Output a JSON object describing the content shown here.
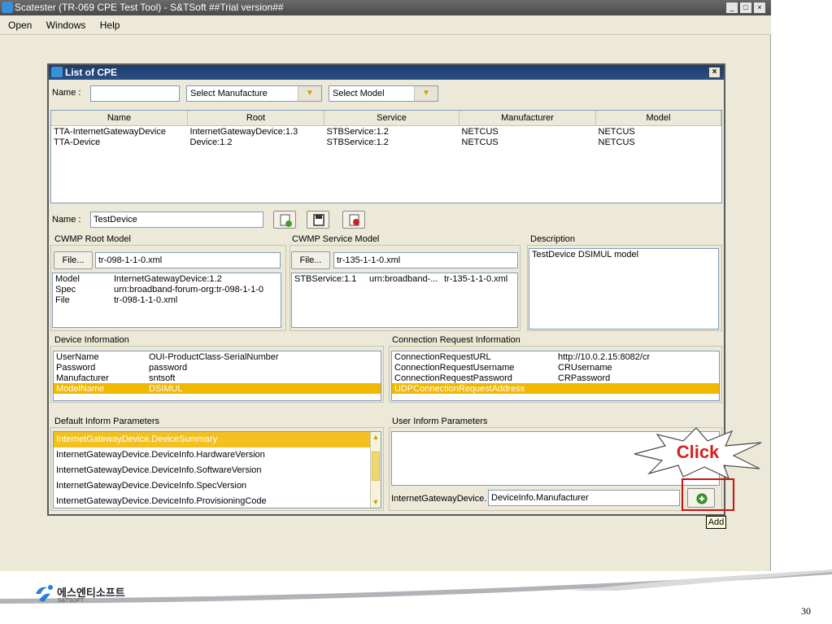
{
  "window": {
    "title": "Scatester (TR-069 CPE Test Tool) - S&TSoft ##Trial version##",
    "menu": [
      "Open",
      "Windows",
      "Help"
    ]
  },
  "cpe_dialog": {
    "title": "List of CPE",
    "filter": {
      "name_label": "Name :",
      "name_value": "",
      "manufacturer_select": "Select Manufacture",
      "model_select": "Select Model"
    },
    "table": {
      "columns": [
        "Name",
        "Root",
        "Service",
        "Manufacturer",
        "Model"
      ],
      "rows": [
        [
          "TTA-InternetGatewayDevice",
          "InternetGatewayDevice:1.3",
          "STBService:1.2",
          "NETCUS",
          "NETCUS"
        ],
        [
          "TTA-Device",
          "Device:1.2",
          "STBService:1.2",
          "NETCUS",
          "NETCUS"
        ]
      ]
    },
    "device_name": {
      "label": "Name :",
      "value": "TestDevice"
    },
    "root_model": {
      "label": "CWMP Root Model",
      "file_button": "File...",
      "file_value": "tr-098-1-1-0.xml",
      "rows": [
        [
          "Model",
          "InternetGatewayDevice:1.2"
        ],
        [
          "Spec",
          "urn:broadband-forum-org:tr-098-1-1-0"
        ],
        [
          "File",
          "tr-098-1-1-0.xml"
        ]
      ]
    },
    "service_model": {
      "label": "CWMP Service Model",
      "file_button": "File...",
      "file_value": "tr-135-1-1-0.xml",
      "rows": [
        [
          "STBService:1.1",
          "urn:broadband-...",
          "tr-135-1-1-0.xml"
        ]
      ]
    },
    "description": {
      "label": "Description",
      "value": "TestDevice DSIMUL model"
    },
    "device_info": {
      "label": "Device Information",
      "rows": [
        [
          "UserName",
          "OUI-ProductClass-SerialNumber"
        ],
        [
          "Password",
          "password"
        ],
        [
          "Manufacturer",
          "sntsoft"
        ],
        [
          "ModelName",
          "DSIMUL"
        ]
      ],
      "selected_index": 3
    },
    "conn_request": {
      "label": "Connection Request Information",
      "rows": [
        [
          "ConnectionRequestURL",
          "http://10.0.2.15:8082/cr"
        ],
        [
          "ConnectionRequestUsername",
          "CRUsername"
        ],
        [
          "ConnectionRequestPassword",
          "CRPassword"
        ],
        [
          "UDPConnectionRequestAddress",
          ""
        ]
      ],
      "selected_index": 3
    },
    "default_inform": {
      "label": "Default Inform Parameters",
      "items": [
        "InternetGatewayDevice.DeviceSummary",
        "InternetGatewayDevice.DeviceInfo.HardwareVersion",
        "InternetGatewayDevice.DeviceInfo.SoftwareVersion",
        "InternetGatewayDevice.DeviceInfo.SpecVersion",
        "InternetGatewayDevice.DeviceInfo.ProvisioningCode"
      ],
      "selected_index": 0
    },
    "user_inform": {
      "label": "User Inform Parameters",
      "prefix": "InternetGatewayDevice.",
      "input_value": "DeviceInfo.Manufacturer",
      "add_tooltip": "Add"
    }
  },
  "callout": {
    "text": "Click",
    "color": "#d62020"
  },
  "footer": {
    "company_korean": "에스엔티소프트",
    "company_english": "S&TSOFT",
    "page_number": "30"
  }
}
